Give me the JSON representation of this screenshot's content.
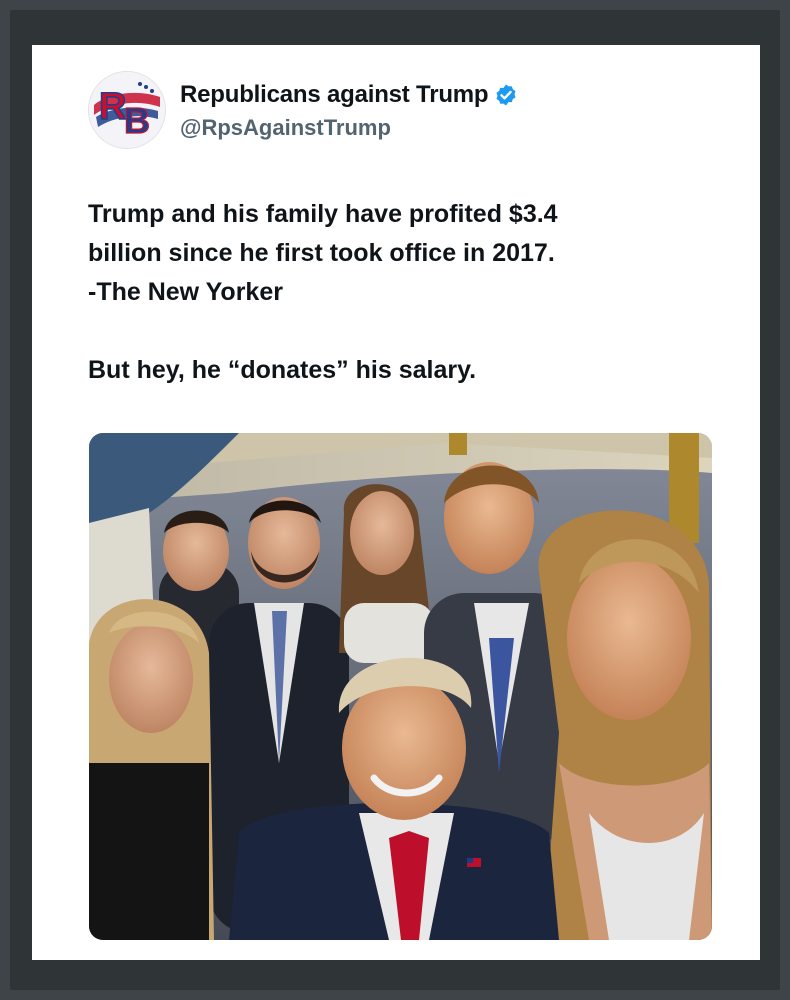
{
  "post": {
    "author": {
      "display_name": "Republicans against Trump",
      "handle": "@RpsAgainstTrump",
      "avatar_letters": "RB",
      "verified": true
    },
    "text": {
      "line1": "Trump and his family have profited $3.4",
      "line2": "billion since he first took office in 2017.",
      "line3": "-The New Yorker",
      "line4": "But hey, he “donates” his salary."
    },
    "media": {
      "icon": "photo-icon",
      "description_kind": "group-selfie"
    }
  },
  "colors": {
    "page_bg": "#3e4448",
    "frame": "#2f3437",
    "card_bg": "#ffffff",
    "text_primary": "#0f1419",
    "text_secondary": "#536471",
    "verified_blue": "#1d9bf0"
  }
}
